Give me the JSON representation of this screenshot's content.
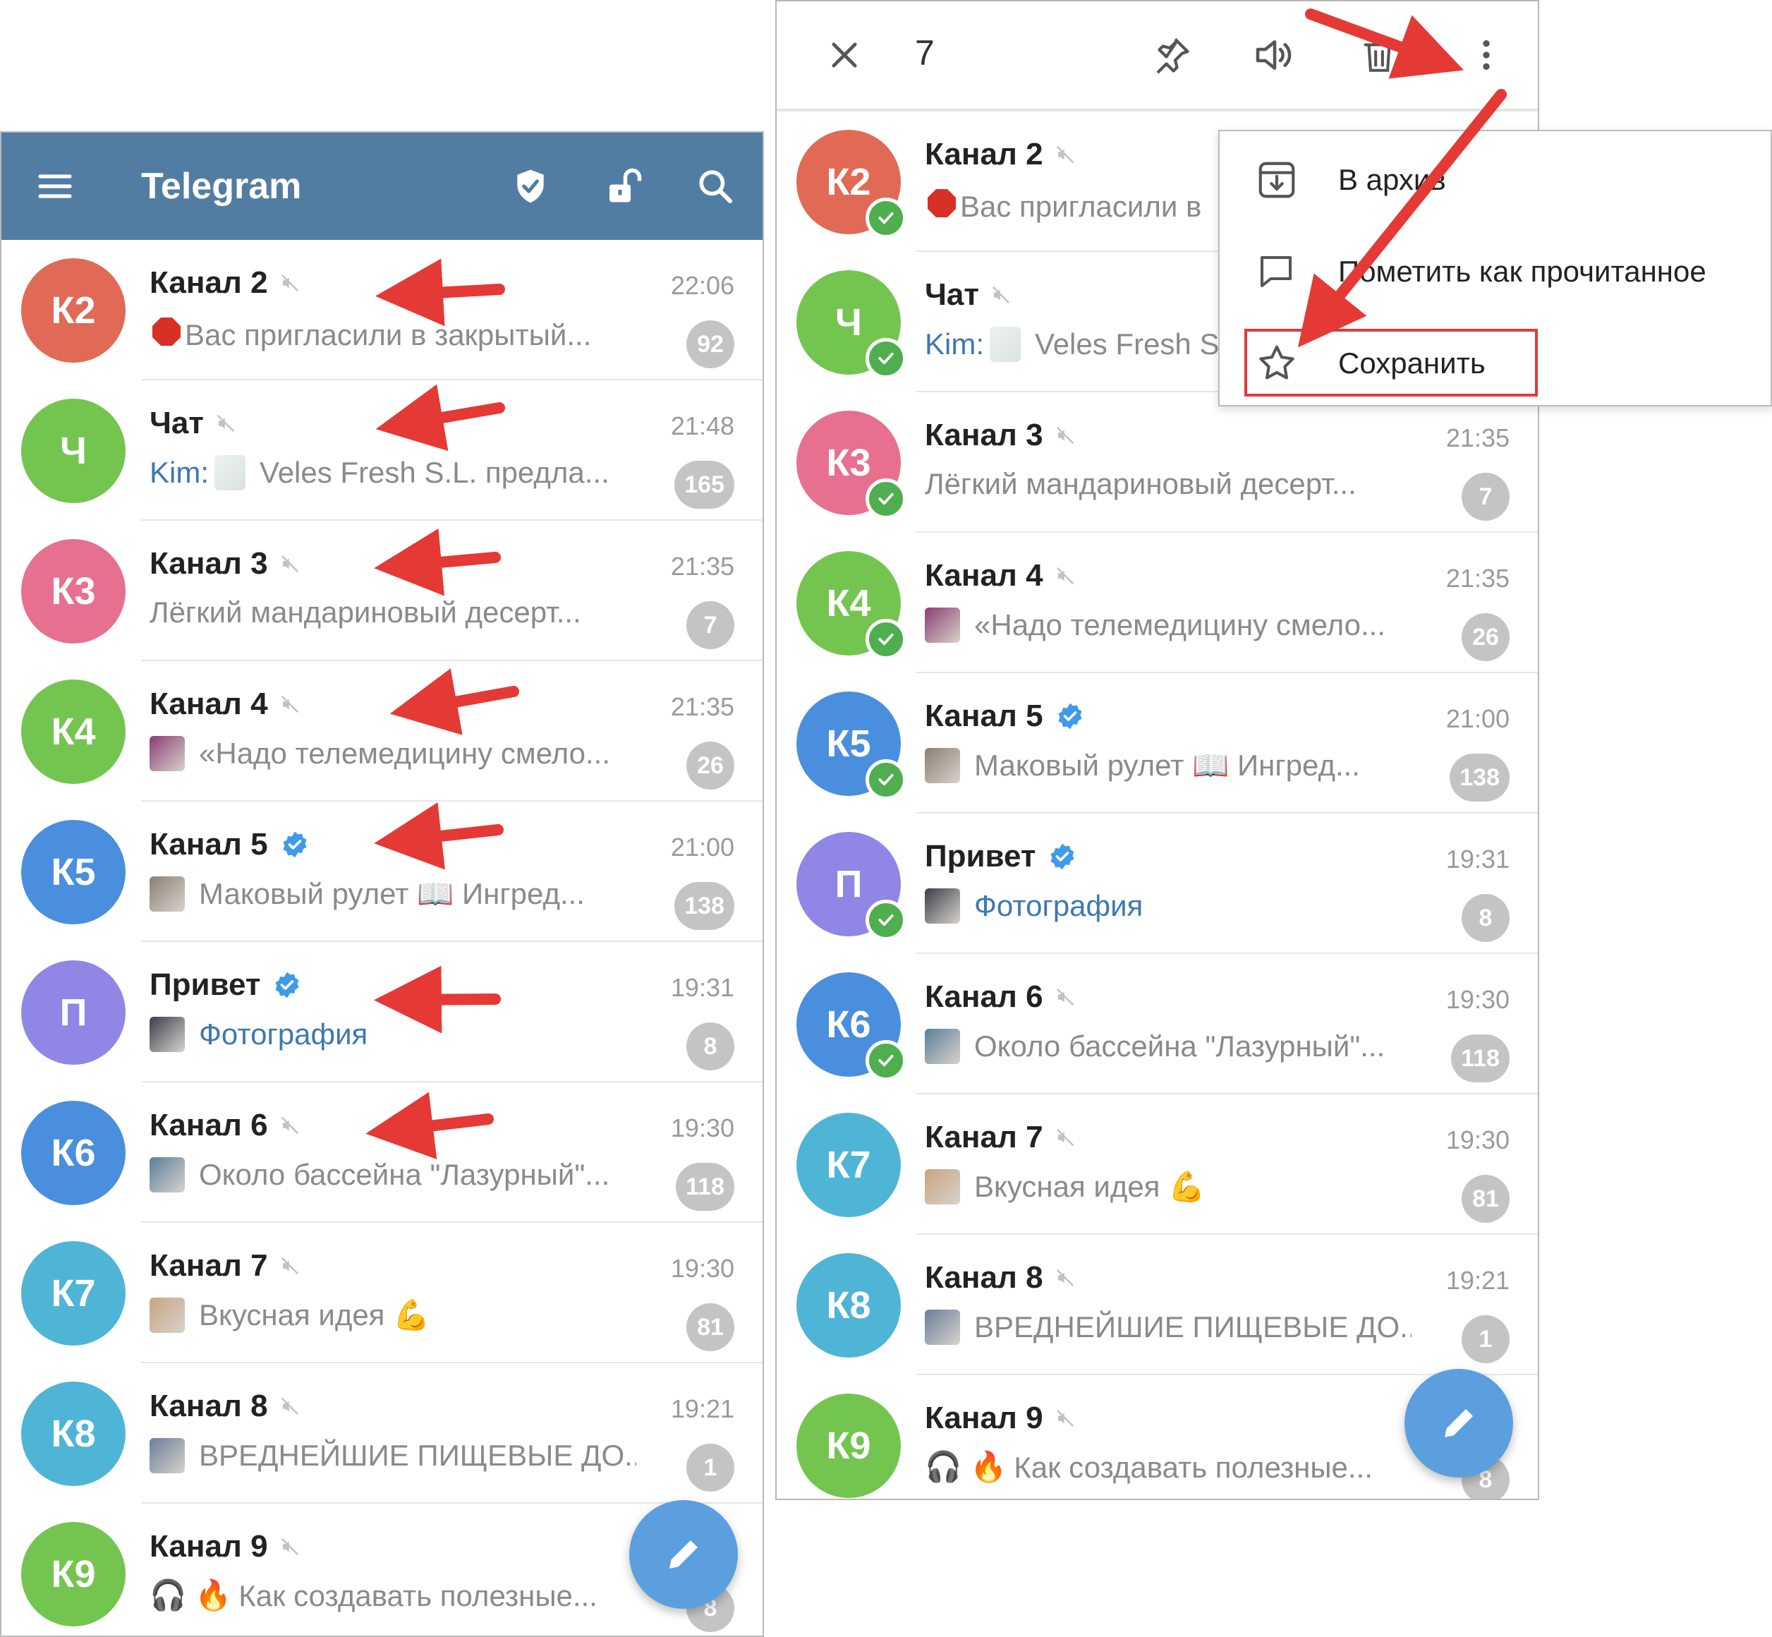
{
  "left": {
    "app_title": "Telegram",
    "chats": [
      {
        "id": "k2",
        "avatar": "К2",
        "color": "#e06a55",
        "name": "Канал 2",
        "muted": true,
        "verified": false,
        "time": "22:06",
        "preview": "Вас пригласили в закрытый...",
        "prefix_emoji": "stop",
        "sender": "",
        "link": false,
        "thumb": "",
        "badge": "92"
      },
      {
        "id": "chat",
        "avatar": "Ч",
        "color": "#74c550",
        "name": "Чат",
        "muted": true,
        "verified": false,
        "time": "21:48",
        "preview": "Veles Fresh S.L. предла...",
        "prefix_emoji": "",
        "sender": "Kim:",
        "link": false,
        "thumb": "blur",
        "badge": "165"
      },
      {
        "id": "k3",
        "avatar": "К3",
        "color": "#e8708f",
        "name": "Канал 3",
        "muted": true,
        "verified": false,
        "time": "21:35",
        "preview": "Лёгкий мандариновый десерт...",
        "prefix_emoji": "",
        "sender": "",
        "link": false,
        "thumb": "",
        "badge": "7"
      },
      {
        "id": "k4",
        "avatar": "К4",
        "color": "#74c550",
        "name": "Канал 4",
        "muted": true,
        "verified": false,
        "time": "21:35",
        "preview": "«Надо телемедицину смело...",
        "prefix_emoji": "",
        "sender": "",
        "link": false,
        "thumb": "#8a3c74",
        "badge": "26"
      },
      {
        "id": "k5",
        "avatar": "К5",
        "color": "#4a8fdd",
        "name": "Канал 5",
        "muted": false,
        "verified": true,
        "time": "21:00",
        "preview": "Маковый рулет  📖 Ингред...",
        "prefix_emoji": "",
        "sender": "",
        "link": false,
        "thumb": "#8b8072",
        "badge": "138"
      },
      {
        "id": "privet",
        "avatar": "П",
        "color": "#8f86e6",
        "name": "Привет",
        "muted": false,
        "verified": true,
        "time": "19:31",
        "preview": "Фотография",
        "prefix_emoji": "",
        "sender": "",
        "link": true,
        "thumb": "#3a3f4a",
        "badge": "8"
      },
      {
        "id": "k6",
        "avatar": "К6",
        "color": "#4a8fdd",
        "name": "Канал 6",
        "muted": true,
        "verified": false,
        "time": "19:30",
        "preview": "Около бассейна \"Лазурный\"...",
        "prefix_emoji": "",
        "sender": "",
        "link": false,
        "thumb": "#5a7f9a",
        "badge": "118"
      },
      {
        "id": "k7",
        "avatar": "К7",
        "color": "#4fb5d6",
        "name": "Канал 7",
        "muted": true,
        "verified": false,
        "time": "19:30",
        "preview": "Вкусная идея 💪",
        "prefix_emoji": "",
        "sender": "",
        "link": false,
        "thumb": "#c8a480",
        "badge": "81"
      },
      {
        "id": "k8",
        "avatar": "К8",
        "color": "#4fb5d6",
        "name": "Канал 8",
        "muted": true,
        "verified": false,
        "time": "19:21",
        "preview": "ВРЕДНЕЙШИЕ ПИЩЕВЫЕ ДО...",
        "prefix_emoji": "",
        "sender": "",
        "link": false,
        "thumb": "#6a7e9b",
        "badge": "1"
      },
      {
        "id": "k9",
        "avatar": "К9",
        "color": "#74c550",
        "name": "Канал 9",
        "muted": true,
        "verified": false,
        "time": "",
        "preview": "Как создавать полезные...",
        "prefix_emoji": "🎧 🔥",
        "sender": "",
        "link": false,
        "thumb": "",
        "badge": "8"
      }
    ]
  },
  "right": {
    "selected_count": "7",
    "chats": [
      {
        "id": "k2",
        "avatar": "К2",
        "color": "#e06a55",
        "name": "Канал 2",
        "muted": true,
        "verified": false,
        "selected": true,
        "time": "",
        "preview": "Вас пригласили в",
        "prefix_emoji": "stop",
        "sender": "",
        "link": false,
        "thumb": "",
        "badge": ""
      },
      {
        "id": "chat",
        "avatar": "Ч",
        "color": "#74c550",
        "name": "Чат",
        "muted": true,
        "verified": false,
        "selected": true,
        "time": "",
        "preview": "Veles Fresh S",
        "prefix_emoji": "",
        "sender": "Kim:",
        "link": false,
        "thumb": "blur",
        "badge": ""
      },
      {
        "id": "k3",
        "avatar": "К3",
        "color": "#e8708f",
        "name": "Канал 3",
        "muted": true,
        "verified": false,
        "selected": true,
        "time": "21:35",
        "preview": "Лёгкий мандариновый десерт...",
        "prefix_emoji": "",
        "sender": "",
        "link": false,
        "thumb": "",
        "badge": "7"
      },
      {
        "id": "k4",
        "avatar": "К4",
        "color": "#74c550",
        "name": "Канал 4",
        "muted": true,
        "verified": false,
        "selected": true,
        "time": "21:35",
        "preview": "«Надо телемедицину смело...",
        "prefix_emoji": "",
        "sender": "",
        "link": false,
        "thumb": "#8a3c74",
        "badge": "26"
      },
      {
        "id": "k5",
        "avatar": "К5",
        "color": "#4a8fdd",
        "name": "Канал 5",
        "muted": false,
        "verified": true,
        "selected": true,
        "time": "21:00",
        "preview": "Маковый рулет  📖 Ингред...",
        "prefix_emoji": "",
        "sender": "",
        "link": false,
        "thumb": "#8b8072",
        "badge": "138"
      },
      {
        "id": "privet",
        "avatar": "П",
        "color": "#8f86e6",
        "name": "Привет",
        "muted": false,
        "verified": true,
        "selected": true,
        "time": "19:31",
        "preview": "Фотография",
        "prefix_emoji": "",
        "sender": "",
        "link": true,
        "thumb": "#3a3f4a",
        "badge": "8"
      },
      {
        "id": "k6",
        "avatar": "К6",
        "color": "#4a8fdd",
        "name": "Канал 6",
        "muted": true,
        "verified": false,
        "selected": true,
        "time": "19:30",
        "preview": "Около бассейна \"Лазурный\"...",
        "prefix_emoji": "",
        "sender": "",
        "link": false,
        "thumb": "#5a7f9a",
        "badge": "118"
      },
      {
        "id": "k7",
        "avatar": "К7",
        "color": "#4fb5d6",
        "name": "Канал 7",
        "muted": true,
        "verified": false,
        "selected": false,
        "time": "19:30",
        "preview": "Вкусная идея 💪",
        "prefix_emoji": "",
        "sender": "",
        "link": false,
        "thumb": "#c8a480",
        "badge": "81"
      },
      {
        "id": "k8",
        "avatar": "К8",
        "color": "#4fb5d6",
        "name": "Канал 8",
        "muted": true,
        "verified": false,
        "selected": false,
        "time": "19:21",
        "preview": "ВРЕДНЕЙШИЕ ПИЩЕВЫЕ ДО...",
        "prefix_emoji": "",
        "sender": "",
        "link": false,
        "thumb": "#6a7e9b",
        "badge": "1"
      },
      {
        "id": "k9",
        "avatar": "К9",
        "color": "#74c550",
        "name": "Канал 9",
        "muted": true,
        "verified": false,
        "selected": false,
        "time": "",
        "preview": "Как создавать полезные...",
        "prefix_emoji": "🎧 🔥",
        "sender": "",
        "link": false,
        "thumb": "",
        "badge": "8"
      }
    ],
    "menu": {
      "archive": "В архив",
      "mark_read": "Пометить как прочитанное",
      "save": "Сохранить"
    }
  },
  "colors": {
    "header": "#527da3",
    "accent_link": "#3d78b2",
    "badge": "#c4c4c4",
    "check": "#4fae4e",
    "fab": "#5b9fdf",
    "arrow": "#e53935"
  },
  "icons": {
    "left_header": [
      "menu-icon",
      "shield-icon",
      "unlock-icon",
      "search-icon"
    ],
    "right_header": [
      "close-icon",
      "pin-icon",
      "unmute-icon",
      "trash-icon",
      "more-vertical-icon"
    ],
    "menu": [
      "archive-icon",
      "chat-bubble-icon",
      "star-icon"
    ],
    "fab": "pencil-icon"
  }
}
